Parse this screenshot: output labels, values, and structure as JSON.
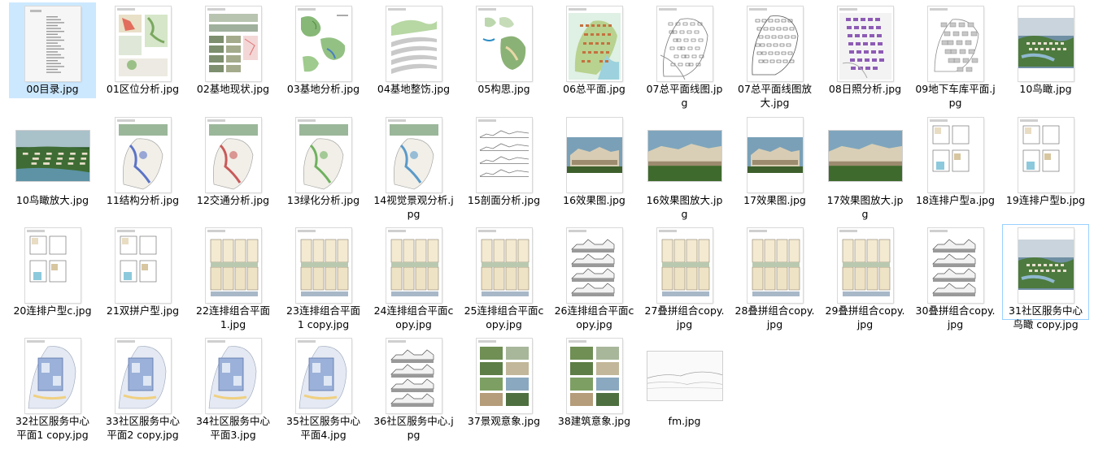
{
  "files": [
    {
      "name": "00目录.jpg",
      "kind": "toc",
      "selected": true
    },
    {
      "name": "01区位分析.jpg",
      "kind": "location"
    },
    {
      "name": "02基地现状.jpg",
      "kind": "photos"
    },
    {
      "name": "03基地分析.jpg",
      "kind": "greenmap"
    },
    {
      "name": "04基地整饬.jpg",
      "kind": "terrain"
    },
    {
      "name": "05构思.jpg",
      "kind": "concept"
    },
    {
      "name": "06总平面.jpg",
      "kind": "masterplan"
    },
    {
      "name": "07总平面线图.jpg",
      "kind": "lineplan"
    },
    {
      "name": "07总平面线图放大.jpg",
      "kind": "lineplan_land"
    },
    {
      "name": "08日照分析.jpg",
      "kind": "sunlight"
    },
    {
      "name": "09地下车库平面.jpg",
      "kind": "garage"
    },
    {
      "name": "10鸟瞰.jpg",
      "kind": "aerial_portrait"
    },
    {
      "name": "10鸟瞰放大.jpg",
      "kind": "aerial_land"
    },
    {
      "name": "11结构分析.jpg",
      "kind": "analysis_blue"
    },
    {
      "name": "12交通分析.jpg",
      "kind": "analysis_red"
    },
    {
      "name": "13绿化分析.jpg",
      "kind": "analysis_green"
    },
    {
      "name": "14视觉景观分析.jpg",
      "kind": "analysis_view"
    },
    {
      "name": "15剖面分析.jpg",
      "kind": "sections"
    },
    {
      "name": "16效果图.jpg",
      "kind": "render_portrait"
    },
    {
      "name": "16效果图放大.jpg",
      "kind": "render_land"
    },
    {
      "name": "17效果图.jpg",
      "kind": "render_portrait"
    },
    {
      "name": "17效果图放大.jpg",
      "kind": "render_land"
    },
    {
      "name": "18连排户型a.jpg",
      "kind": "unitplan"
    },
    {
      "name": "19连排户型b.jpg",
      "kind": "unitplan"
    },
    {
      "name": "20连排户型c.jpg",
      "kind": "unitplan"
    },
    {
      "name": "21双拼户型.jpg",
      "kind": "unitplan"
    },
    {
      "name": "22连排组合平面1.jpg",
      "kind": "comboplan"
    },
    {
      "name": "23连排组合平面 1 copy.jpg",
      "kind": "comboplan"
    },
    {
      "name": "24连排组合平面copy.jpg",
      "kind": "comboplan"
    },
    {
      "name": "25连排组合平面copy.jpg",
      "kind": "comboplan"
    },
    {
      "name": "26连排组合平面copy.jpg",
      "kind": "elevation"
    },
    {
      "name": "27叠拼组合copy.jpg",
      "kind": "comboplan"
    },
    {
      "name": "28叠拼组合copy.jpg",
      "kind": "comboplan"
    },
    {
      "name": "29叠拼组合copy.jpg",
      "kind": "comboplan"
    },
    {
      "name": "30叠拼组合copy.jpg",
      "kind": "elevation"
    },
    {
      "name": "31社区服务中心鸟瞰 copy.jpg",
      "kind": "aerial_small",
      "hover": true
    },
    {
      "name": "32社区服务中心平面1 copy.jpg",
      "kind": "center_plan"
    },
    {
      "name": "33社区服务中心平面2 copy.jpg",
      "kind": "center_plan"
    },
    {
      "name": "34社区服务中心平面3.jpg",
      "kind": "center_plan"
    },
    {
      "name": "35社区服务中心平面4.jpg",
      "kind": "center_plan"
    },
    {
      "name": "36社区服务中心.jpg",
      "kind": "elevation"
    },
    {
      "name": "37景观意象.jpg",
      "kind": "collage"
    },
    {
      "name": "38建筑意象.jpg",
      "kind": "collage"
    },
    {
      "name": "fm.jpg",
      "kind": "cover"
    }
  ]
}
